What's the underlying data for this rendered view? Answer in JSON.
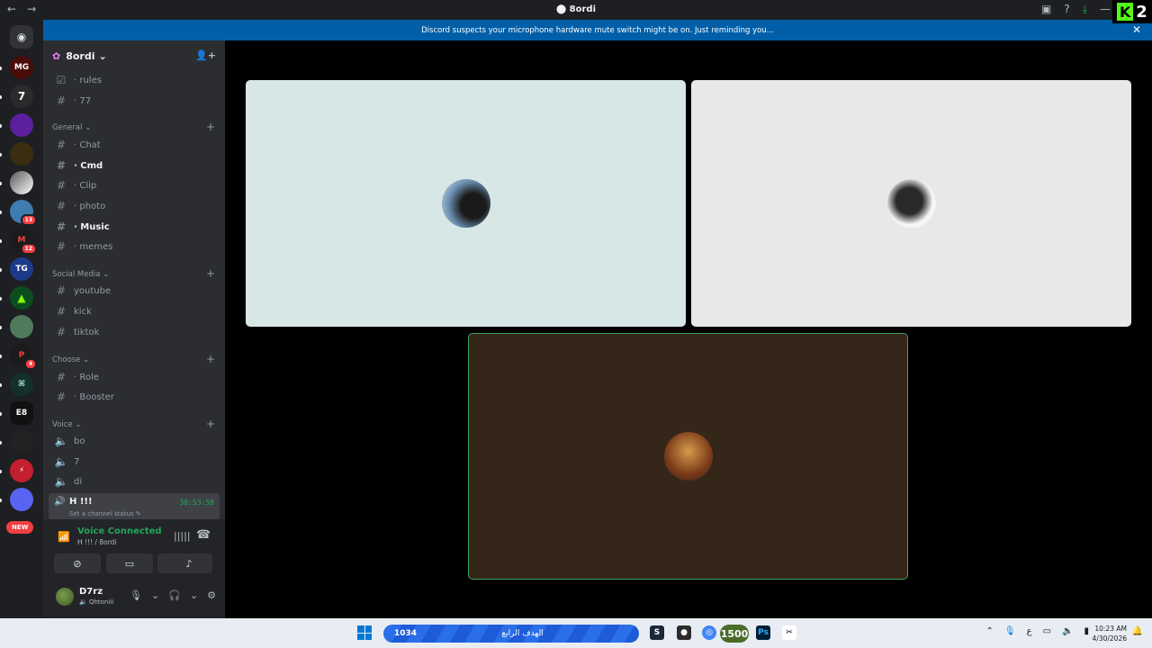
{
  "window": {
    "title": "8ordi",
    "back": "←",
    "forward": "→"
  },
  "kick_badge": {
    "logo": "K",
    "count": "2"
  },
  "banner": {
    "text": "Discord suspects your microphone hardware mute switch might be on. Just reminding you...",
    "close": "✕"
  },
  "server": {
    "name": "8ordi"
  },
  "channels_top": [
    {
      "label": "· rules",
      "icon": "☑"
    },
    {
      "label": "· 77",
      "icon": "#"
    }
  ],
  "categories": {
    "general": "General",
    "social": "Social Media",
    "choose": "Choose",
    "voice": "Voice"
  },
  "general_channels": [
    "· Chat",
    "· Cmd",
    "· Clip",
    "· photo",
    "· Music",
    "· memes"
  ],
  "social_channels": [
    "youtube",
    "kick",
    "tiktok"
  ],
  "choose_channels": [
    "· Role",
    "· Booster"
  ],
  "voice_channels": [
    "bo",
    "7",
    "di"
  ],
  "active_voice": {
    "name": "H !!!",
    "timer": "38:53:58",
    "status": "Set a channel status"
  },
  "guild_badges": {
    "g8": "13",
    "g9": "12",
    "g13": "4",
    "new": "NEW"
  },
  "guild_labels": {
    "g1": "MG",
    "g11": "TG",
    "g15": "E8"
  },
  "voice_panel": {
    "title": "Voice Connected",
    "subtitle": "H !!! / 8ordi"
  },
  "user": {
    "name": "D7rz",
    "status": "Qhtoniii"
  },
  "taskbar": {
    "search_left": "1034",
    "search_label": "الهدف الرابع",
    "pill": "1500",
    "time": "10:23 AM",
    "date": "4/30/2026",
    "lang": "ع"
  },
  "colors": {
    "accent_green": "#23a55a",
    "banner": "#005fa8",
    "tile1": "#d7e7e5",
    "tile2": "#e8e8e8",
    "tile3": "#35261a"
  }
}
